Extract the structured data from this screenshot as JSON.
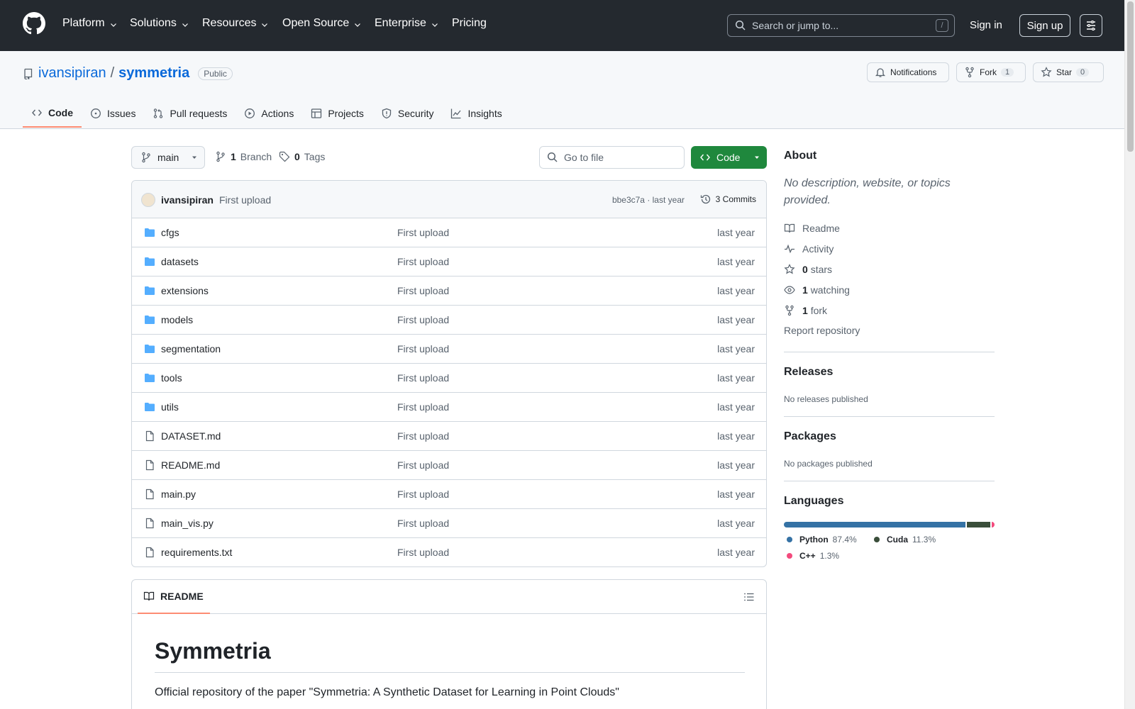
{
  "header": {
    "nav": [
      "Platform",
      "Solutions",
      "Resources",
      "Open Source",
      "Enterprise",
      "Pricing"
    ],
    "search_placeholder": "Search or jump to...",
    "search_shortcut": "/",
    "signin": "Sign in",
    "signup": "Sign up"
  },
  "repo": {
    "owner": "ivansipiran",
    "separator": "/",
    "name": "symmetria",
    "visibility": "Public",
    "notifications_label": "Notifications",
    "fork_label": "Fork",
    "fork_count": "1",
    "star_label": "Star",
    "star_count": "0",
    "tabs": [
      "Code",
      "Issues",
      "Pull requests",
      "Actions",
      "Projects",
      "Security",
      "Insights"
    ]
  },
  "toolbar": {
    "branch": "main",
    "branch_count": "1",
    "branch_label": "Branch",
    "tag_count": "0",
    "tag_label": "Tags",
    "goto_placeholder": "Go to file",
    "code_label": "Code"
  },
  "commit": {
    "author": "ivansipiran",
    "message": "First upload",
    "hash_time": "bbe3c7a · last year",
    "commits_label": "3 Commits"
  },
  "files": [
    {
      "name": "cfgs",
      "type": "dir",
      "message": "First upload",
      "time": "last year"
    },
    {
      "name": "datasets",
      "type": "dir",
      "message": "First upload",
      "time": "last year"
    },
    {
      "name": "extensions",
      "type": "dir",
      "message": "First upload",
      "time": "last year"
    },
    {
      "name": "models",
      "type": "dir",
      "message": "First upload",
      "time": "last year"
    },
    {
      "name": "segmentation",
      "type": "dir",
      "message": "First upload",
      "time": "last year"
    },
    {
      "name": "tools",
      "type": "dir",
      "message": "First upload",
      "time": "last year"
    },
    {
      "name": "utils",
      "type": "dir",
      "message": "First upload",
      "time": "last year"
    },
    {
      "name": "DATASET.md",
      "type": "file",
      "message": "First upload",
      "time": "last year"
    },
    {
      "name": "README.md",
      "type": "file",
      "message": "First upload",
      "time": "last year"
    },
    {
      "name": "main.py",
      "type": "file",
      "message": "First upload",
      "time": "last year"
    },
    {
      "name": "main_vis.py",
      "type": "file",
      "message": "First upload",
      "time": "last year"
    },
    {
      "name": "requirements.txt",
      "type": "file",
      "message": "First upload",
      "time": "last year"
    }
  ],
  "readme": {
    "tab_label": "README",
    "title": "Symmetria",
    "paragraph": "Official repository of the paper \"Symmetria: A Synthetic Dataset for Learning in Point Clouds\""
  },
  "sidebar": {
    "about_title": "About",
    "description": "No description, website, or topics provided.",
    "readme": "Readme",
    "activity": "Activity",
    "stars_count": "0",
    "stars_label": "stars",
    "watching_count": "1",
    "watching_label": "watching",
    "fork_count": "1",
    "fork_label": "fork",
    "report": "Report repository",
    "releases_title": "Releases",
    "releases_text": "No releases published",
    "packages_title": "Packages",
    "packages_text": "No packages published",
    "languages_title": "Languages",
    "languages": [
      {
        "name": "Python",
        "percent": "87.4%",
        "value": 87.4,
        "color": "#3572A5"
      },
      {
        "name": "Cuda",
        "percent": "11.3%",
        "value": 11.3,
        "color": "#3A4E3A"
      },
      {
        "name": "C++",
        "percent": "1.3%",
        "value": 1.3,
        "color": "#f34b7d"
      }
    ]
  },
  "colors": {
    "header_bg": "#24292f",
    "link": "#0969da",
    "code_button": "#1f883d",
    "tab_underline": "#fd8c73",
    "folder": "#54aeff"
  }
}
